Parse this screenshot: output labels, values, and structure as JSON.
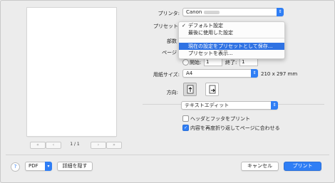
{
  "printer": {
    "label": "プリンタ:",
    "value": "Canon"
  },
  "preset": {
    "label": "プリセット",
    "menu": [
      {
        "label": "デフォルト設定",
        "checked": true
      },
      {
        "label": "最後に使用した設定",
        "checked": false
      },
      {
        "label": "現在の設定をプリセットとして保存...",
        "highlighted": true
      },
      {
        "label": "プリセットを表示...",
        "checked": false
      }
    ]
  },
  "copies": {
    "label": "部数"
  },
  "pages": {
    "label": "ページ",
    "from_label": "開始:",
    "from_value": "1",
    "to_label": "終了:",
    "to_value": "1"
  },
  "paper_size": {
    "label": "用紙サイズ:",
    "value": "A4",
    "dimensions": "210 x 297 mm"
  },
  "orientation": {
    "label": "方向:"
  },
  "app_section": {
    "value": "テキストエディット"
  },
  "options": {
    "header_footer": {
      "label": "ヘッダとフッタをプリント",
      "checked": false
    },
    "rewrap": {
      "label": "内容を再度折り返してページに合わせる",
      "checked": true
    }
  },
  "preview_nav": {
    "first": "«",
    "prev": "‹",
    "page_indicator": "1 / 1",
    "next": "›",
    "last": "»"
  },
  "footer": {
    "help": "?",
    "pdf": "PDF",
    "hide_details": "詳細を隠す",
    "cancel": "キャンセル",
    "print": "プリント"
  },
  "colors": {
    "accent": "#2f7ef5",
    "highlight": "#2f72e3"
  }
}
